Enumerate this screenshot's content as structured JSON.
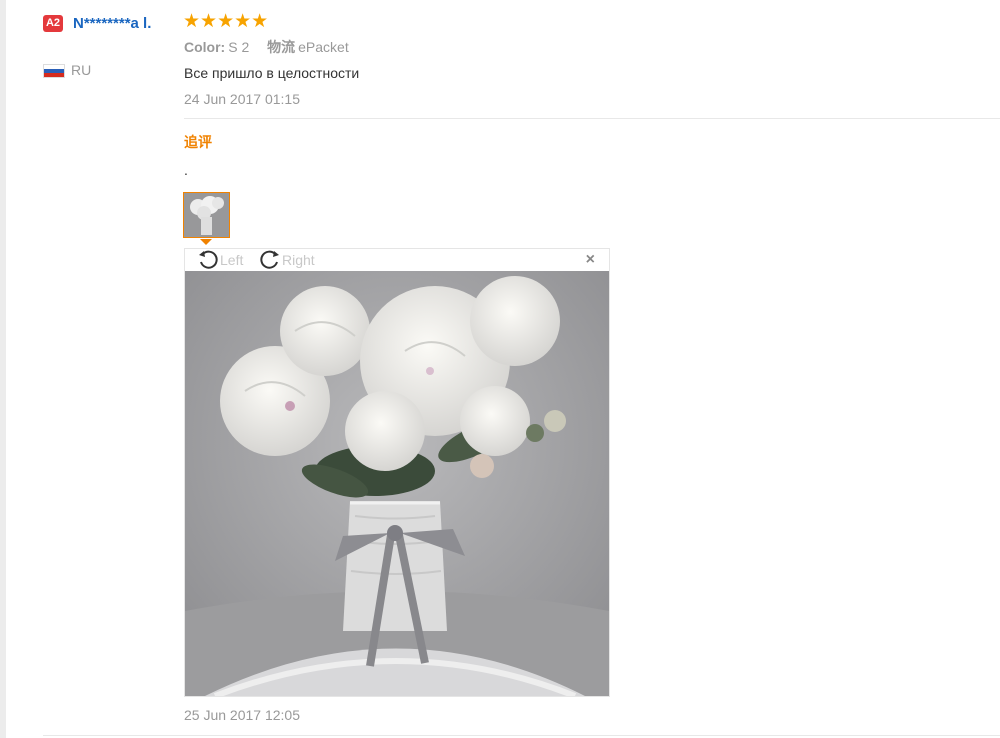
{
  "reviewer": {
    "badge": "A2",
    "name": "N********a l.",
    "country": "RU",
    "flag_colors": [
      "#ffffff",
      "#2a5fb8",
      "#d52b1e"
    ]
  },
  "review": {
    "rating": 5,
    "stars": "★★★★★",
    "color_label": "Color:",
    "color_value": "S 2",
    "shipping_label": "物流",
    "shipping_value": "ePacket",
    "text": "Все пришло в целостности",
    "date": "24 Jun 2017 01:15"
  },
  "followup": {
    "label": "追评",
    "text": ".",
    "date": "25 Jun 2017 12:05"
  },
  "viewer": {
    "rotate_left_label": "Left",
    "rotate_right_label": "Right",
    "close_label": "×",
    "icons": [
      "rotate-left-icon",
      "rotate-right-icon",
      "close-icon"
    ]
  },
  "colors": {
    "username": "#1a66c0",
    "stars": "#f7a300",
    "followup_accent": "#f08200"
  }
}
